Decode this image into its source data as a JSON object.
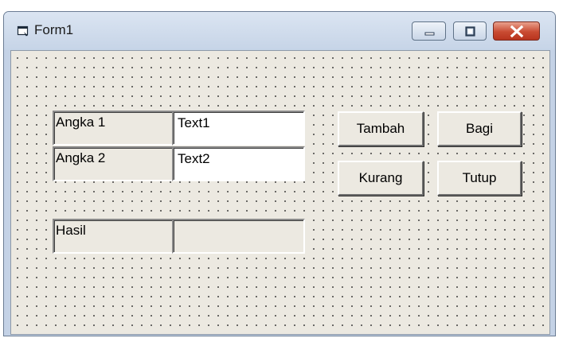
{
  "window": {
    "title": "Form1",
    "controls": {
      "minimize": "minimize-icon",
      "maximize": "maximize-icon",
      "close": "close-icon"
    }
  },
  "form": {
    "labels": {
      "angka1": "Angka 1",
      "angka2": "Angka 2",
      "hasil": "Hasil"
    },
    "textboxes": {
      "text1": "Text1",
      "text2": "Text2",
      "hasil": ""
    },
    "buttons": {
      "tambah": "Tambah",
      "bagi": "Bagi",
      "kurang": "Kurang",
      "tutup": "Tutup"
    }
  },
  "colors": {
    "form_background": "#ece9e1",
    "titlebar": "#c6d4e7",
    "close_button": "#c94b32"
  }
}
